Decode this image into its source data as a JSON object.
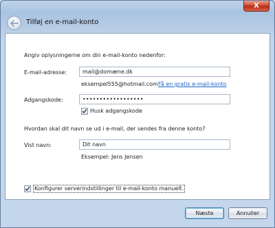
{
  "window": {
    "title": "Tilføj en e-mail-konto",
    "close_glyph": "X"
  },
  "form": {
    "intro": "Angiv oplysningerne om din e-mail-konto nedenfor:",
    "email_label": "E-mail-adresse:",
    "email_value": "mail@domæne.dk",
    "email_example": "eksempel555@hotmail.com",
    "free_account_link": "Få en gratis e-mail-konto",
    "password_label": "Adgangskode:",
    "password_value": "••••••••••••••••••",
    "remember_password_label": "Husk adgangskode",
    "remember_password_checked": true,
    "display_name_question": "Hvordan skal dit navn se ud i e-mail, der sendes fra denne konto?",
    "display_name_label": "Vist navn:",
    "display_name_value": "Dit navn",
    "display_name_example": "Eksempel: Jens Jensen",
    "manual_config_label": "Konfigurer serverindstillinger til e-mail-konto manuelt.",
    "manual_config_checked": true
  },
  "buttons": {
    "next": "Næste",
    "cancel": "Annuller"
  },
  "icons": {
    "back": "back-arrow-icon",
    "close": "close-icon",
    "checkmark": "checkmark-icon"
  },
  "colors": {
    "link": "#1a63c9",
    "close_button": "#c8462c"
  }
}
